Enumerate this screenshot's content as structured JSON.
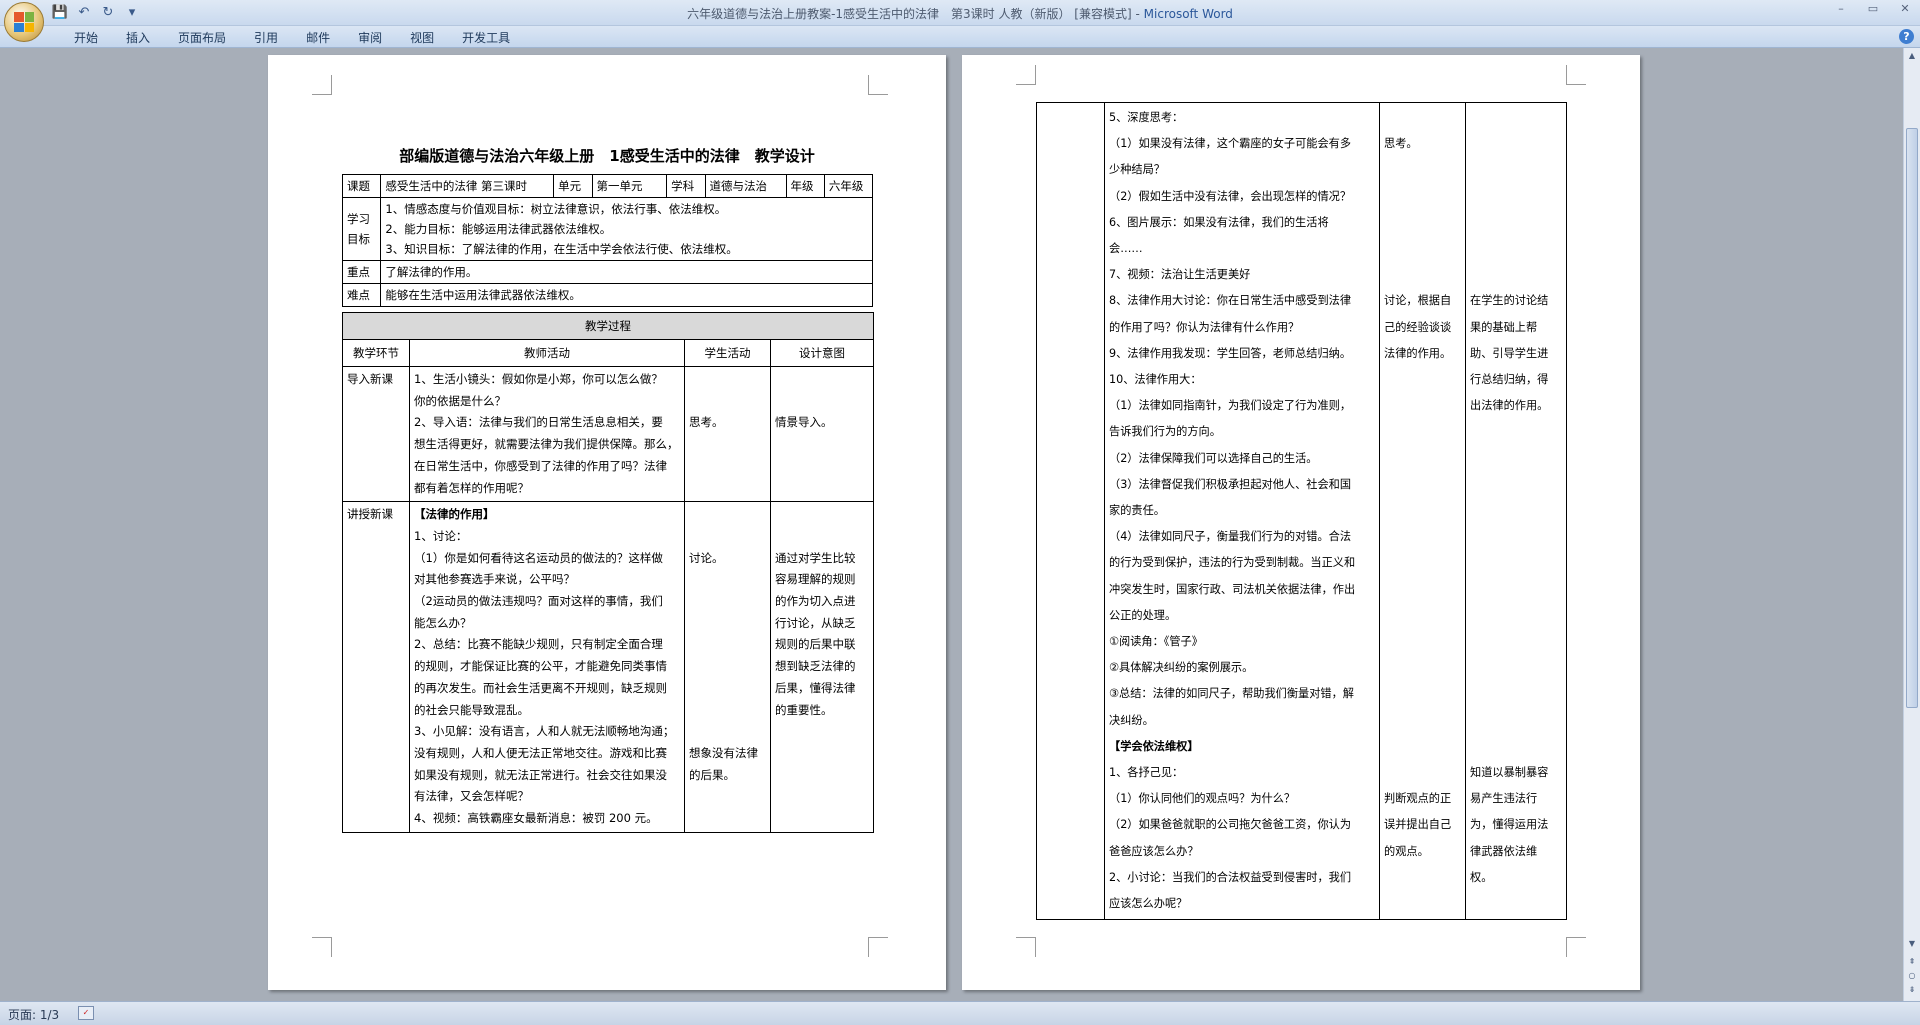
{
  "window": {
    "title": "六年级道德与法治上册教案-1感受生活中的法律　第3课时 人教（新版） [兼容模式]",
    "app_name": "Microsoft Word",
    "controls": [
      "–",
      "▭",
      "✕"
    ]
  },
  "qat": {
    "icons": [
      "save-icon",
      "undo-icon",
      "redo-icon",
      "customize-icon"
    ],
    "glyphs": [
      "💾",
      "↶",
      "↻",
      "▾"
    ]
  },
  "ribbon": {
    "tabs": [
      "开始",
      "插入",
      "页面布局",
      "引用",
      "邮件",
      "审阅",
      "视图",
      "开发工具"
    ],
    "help": "?"
  },
  "page_left": {
    "title": "部编版道德与法治六年级上册　1感受生活中的法律　教学设计",
    "info": {
      "topic_label": "课题",
      "topic_value": "感受生活中的法律 第三课时",
      "unit_label": "单元",
      "unit_value": "第一单元",
      "subject_label": "学科",
      "subject_value": "道德与法治",
      "grade_label": "年级",
      "grade_value": "六年级",
      "goals_label": "学习目标",
      "goals": [
        "1、情感态度与价值观目标：树立法律意识，依法行事、依法维权。",
        "2、能力目标：能够运用法律武器依法维权。",
        "3、知识目标：了解法律的作用，在生活中学会依法行使、依法维权。"
      ],
      "key_label": "重点",
      "key_value": "了解法律的作用。",
      "difficulty_label": "难点",
      "difficulty_value": "能够在生活中运用法律武器依法维权。"
    },
    "process": {
      "header": "教学过程",
      "col_stage": "教学环节",
      "col_teacher": "教师活动",
      "col_student": "学生活动",
      "col_intent": "设计意图",
      "rows": [
        {
          "stage": "导入新课",
          "teacher": [
            "1、生活小镜头：假如你是小郑，你可以怎么做？",
            "你的依据是什么？",
            "2、导入语：法律与我们的日常生活息息相关，要",
            "想生活得更好，就需要法律为我们提供保障。那么，",
            "在日常生活中，你感受到了法律的作用了吗？法律",
            "都有着怎样的作用呢？"
          ],
          "student": [
            "",
            "",
            "思考。",
            "",
            "",
            ""
          ],
          "intent": [
            "",
            "",
            "情景导入。",
            "",
            "",
            ""
          ]
        },
        {
          "stage": "讲授新课",
          "teacher": [
            "【法律的作用】",
            "1、讨论：",
            "（1）你是如何看待这名运动员的做法的？这样做",
            "对其他参赛选手来说，公平吗？",
            "（2运动员的做法违规吗？面对这样的事情，我们",
            "能怎么办？",
            "2、总结：比赛不能缺少规则，只有制定全面合理",
            "的规则，才能保证比赛的公平，才能避免同类事情",
            "的再次发生。而社会生活更离不开规则，缺乏规则",
            "的社会只能导致混乱。",
            "3、小见解：没有语言，人和人就无法顺畅地沟通；",
            "没有规则，人和人便无法正常地交往。游戏和比赛",
            "如果没有规则，就无法正常进行。社会交往如果没",
            "有法律，又会怎样呢？",
            "4、视频：高铁霸座女最新消息：被罚 200 元。"
          ],
          "student": [
            "",
            "",
            "讨论。",
            "",
            "",
            "",
            "",
            "",
            "",
            "",
            "",
            "想象没有法律",
            "的后果。",
            "",
            ""
          ],
          "intent": [
            "",
            "",
            "通过对学生比较",
            "容易理解的规则",
            "的作为切入点进",
            "行讨论，从缺乏",
            "规则的后果中联",
            "想到缺乏法律的",
            "后果，懂得法律",
            "的重要性。",
            "",
            "",
            "",
            "",
            ""
          ]
        }
      ]
    }
  },
  "page_right": {
    "teacher": [
      "5、深度思考：",
      "（1）如果没有法律，这个霸座的女子可能会有多",
      "少种结局？",
      "（2）假如生活中没有法律，会出现怎样的情况？",
      "6、图片展示：如果没有法律，我们的生活将",
      "会……",
      "7、视频：法治让生活更美好",
      "8、法律作用大讨论：你在日常生活中感受到法律",
      "的作用了吗？你认为法律有什么作用？",
      "9、法律作用我发现：学生回答，老师总结归纳。",
      "10、法律作用大：",
      "（1）法律如同指南针，为我们设定了行为准则，",
      "告诉我们行为的方向。",
      "（2）法律保障我们可以选择自己的生活。",
      "（3）法律督促我们积极承担起对他人、社会和国",
      "家的责任。",
      "（4）法律如同尺子，衡量我们行为的对错。合法",
      "的行为受到保护，违法的行为受到制裁。当正义和",
      "冲突发生时，国家行政、司法机关依据法律，作出",
      "公正的处理。",
      "①阅读角：《管子》",
      "②具体解决纠纷的案例展示。",
      "③总结：法律的如同尺子，帮助我们衡量对错，解",
      "决纠纷。",
      "【学会依法维权】",
      "1、各抒己见：",
      "（1）你认同他们的观点吗？为什么？",
      "（2）如果爸爸就职的公司拖欠爸爸工资，你认为",
      "爸爸应该怎么办？",
      "2、小讨论：当我们的合法权益受到侵害时，我们",
      "应该怎么办呢？"
    ],
    "student": [
      "",
      "思考。",
      "",
      "",
      "",
      "",
      "",
      "讨论，根据自",
      "己的经验谈谈",
      "法律的作用。",
      "",
      "",
      "",
      "",
      "",
      "",
      "",
      "",
      "",
      "",
      "",
      "",
      "",
      "",
      "",
      "",
      "判断观点的正",
      "误并提出自己",
      "的观点。",
      "",
      ""
    ],
    "intent": [
      "",
      "",
      "",
      "",
      "",
      "",
      "",
      "在学生的讨论结",
      "果的基础上帮",
      "助、引导学生进",
      "行总结归纳，得",
      "出法律的作用。",
      "",
      "",
      "",
      "",
      "",
      "",
      "",
      "",
      "",
      "",
      "",
      "",
      "",
      "知道以暴制暴容",
      "易产生违法行",
      "为，懂得运用法",
      "律武器依法维",
      "权。",
      ""
    ]
  },
  "status": {
    "page_indicator": "页面: 1/3",
    "lang_icon": "language-check-icon"
  }
}
